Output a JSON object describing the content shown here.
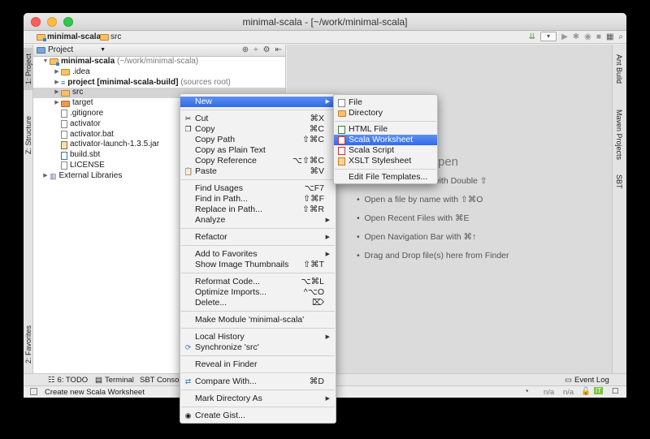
{
  "window": {
    "title": "minimal-scala - [~/work/minimal-scala]"
  },
  "breadcrumb": {
    "project": "minimal-scala",
    "folder": "src"
  },
  "left_tabs": {
    "project": "1: Project",
    "structure": "Z: Structure",
    "favorites": "2: Favorites"
  },
  "right_tabs": {
    "ant": "Ant Build",
    "maven": "Maven Projects",
    "sbt": "SBT"
  },
  "project_panel": {
    "selector": "Project",
    "tree": [
      {
        "name": "minimal-scala",
        "suffix": "(~/work/minimal-scala)",
        "icon": "module-folder-icon"
      },
      {
        "name": ".idea",
        "icon": "folder-icon"
      },
      {
        "name": "project [minimal-scala-build]",
        "suffix": "(sources root)",
        "icon": "source-folder-icon"
      },
      {
        "name": "src",
        "icon": "folder-icon"
      },
      {
        "name": "target",
        "icon": "folder-icon"
      },
      {
        "name": ".gitignore",
        "icon": "file-icon"
      },
      {
        "name": "activator",
        "icon": "file-icon"
      },
      {
        "name": "activator.bat",
        "icon": "file-icon"
      },
      {
        "name": "activator-launch-1.3.5.jar",
        "icon": "jar-icon"
      },
      {
        "name": "build.sbt",
        "icon": "sbt-file-icon"
      },
      {
        "name": "LICENSE",
        "icon": "file-icon"
      },
      {
        "name": "External Libraries",
        "icon": "library-icon"
      }
    ]
  },
  "editor": {
    "title_partial": "pen",
    "hints": [
      "with Double ⇧",
      "Open a file by name with ⇧⌘O",
      "Open Recent Files with ⌘E",
      "Open Navigation Bar with ⌘↑",
      "Drag and Drop file(s) here from Finder"
    ]
  },
  "context_menu": {
    "new": "New",
    "cut": "Cut",
    "cut_sc": "⌘X",
    "copy": "Copy",
    "copy_sc": "⌘C",
    "copy_path": "Copy Path",
    "copy_path_sc": "⇧⌘C",
    "copy_plain": "Copy as Plain Text",
    "copy_ref": "Copy Reference",
    "copy_ref_sc": "⌥⇧⌘C",
    "paste": "Paste",
    "paste_sc": "⌘V",
    "find_usages": "Find Usages",
    "find_usages_sc": "⌥F7",
    "find_in_path": "Find in Path...",
    "find_in_path_sc": "⇧⌘F",
    "replace_in_path": "Replace in Path...",
    "replace_in_path_sc": "⇧⌘R",
    "analyze": "Analyze",
    "refactor": "Refactor",
    "add_favorites": "Add to Favorites",
    "show_thumbs": "Show Image Thumbnails",
    "show_thumbs_sc": "⇧⌘T",
    "reformat": "Reformat Code...",
    "reformat_sc": "⌥⌘L",
    "optimize": "Optimize Imports...",
    "optimize_sc": "^⌥O",
    "delete": "Delete...",
    "delete_sc": "⌦",
    "make_module": "Make Module 'minimal-scala'",
    "local_history": "Local History",
    "synchronize": "Synchronize 'src'",
    "reveal": "Reveal in Finder",
    "compare": "Compare With...",
    "compare_sc": "⌘D",
    "mark_dir": "Mark Directory As",
    "create_gist": "Create Gist..."
  },
  "submenu": {
    "file": "File",
    "directory": "Directory",
    "html_file": "HTML File",
    "scala_worksheet": "Scala Worksheet",
    "scala_script": "Scala Script",
    "xslt": "XSLT Stylesheet",
    "edit_templates": "Edit File Templates..."
  },
  "bottom_tabs": {
    "todo": "6: TODO",
    "terminal": "Terminal",
    "sbt_console": "SBT Console",
    "event_log": "Event Log"
  },
  "status": {
    "message": "Create new Scala Worksheet",
    "na1": "n/a",
    "na2": "n/a"
  },
  "colors": {
    "highlight": "#3470e9",
    "editor_bg": "#dbdbdb",
    "folder": "#f5c26b"
  }
}
